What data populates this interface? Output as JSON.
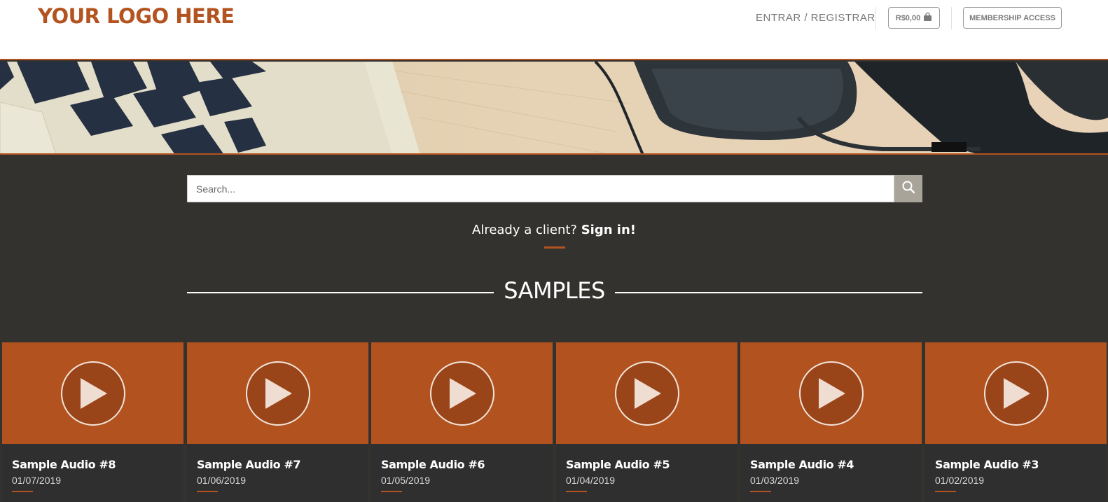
{
  "header": {
    "logo": "YOUR LOGO HERE",
    "nav_link": "ENTRAR / REGISTRAR",
    "cart_total": "R$0,00",
    "membership_label": "MEMBERSHIP ACCESS"
  },
  "search": {
    "placeholder": "Search..."
  },
  "client": {
    "prompt": "Already a client?",
    "signin": "Sign in!"
  },
  "samples": {
    "title": "SAMPLES",
    "items": [
      {
        "title": "Sample Audio #8",
        "date": "01/07/2019"
      },
      {
        "title": "Sample Audio #7",
        "date": "01/06/2019"
      },
      {
        "title": "Sample Audio #6",
        "date": "01/05/2019"
      },
      {
        "title": "Sample Audio #5",
        "date": "01/04/2019"
      },
      {
        "title": "Sample Audio #4",
        "date": "01/03/2019"
      },
      {
        "title": "Sample Audio #3",
        "date": "01/02/2019"
      }
    ]
  },
  "colors": {
    "accent": "#b3531f",
    "dark_bg": "#33322f",
    "card_bg": "#2f2f2f"
  },
  "icons": [
    "bag-icon",
    "search-icon",
    "play-icon"
  ]
}
